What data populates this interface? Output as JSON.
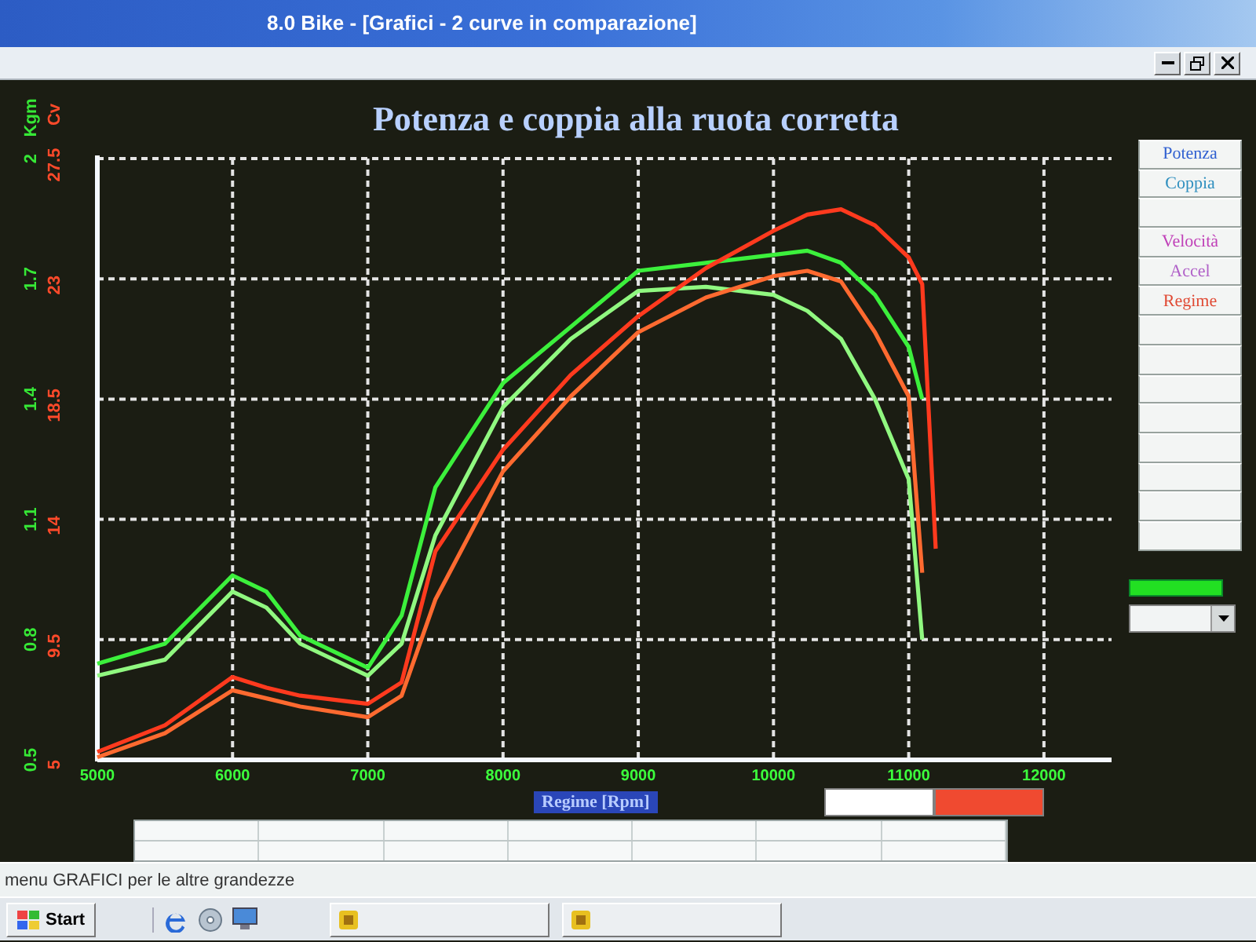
{
  "window": {
    "title": "8.0 Bike - [Grafici - 2 curve in comparazione]"
  },
  "chart": {
    "chart_data": {
      "type": "line",
      "title": "Potenza e coppia alla ruota corretta",
      "xlabel": "Regime [Rpm]",
      "ylabel": "Kgm",
      "y2label": "Cv",
      "grid": true,
      "x": [
        5000,
        5500,
        6000,
        6250,
        6500,
        7000,
        7250,
        7500,
        8000,
        8500,
        9000,
        9500,
        10000,
        10250,
        10500,
        10750,
        11000,
        11100,
        11200
      ],
      "series": [
        {
          "color": "#3cf03c",
          "axis": "y",
          "values": [
            0.74,
            0.79,
            0.96,
            0.92,
            0.81,
            0.73,
            0.86,
            1.18,
            1.44,
            1.58,
            1.72,
            1.74,
            1.76,
            1.77,
            1.74,
            1.66,
            1.53,
            1.4,
            null
          ]
        },
        {
          "color": "#90f880",
          "axis": "y",
          "values": [
            0.71,
            0.75,
            0.92,
            0.88,
            0.79,
            0.71,
            0.79,
            1.06,
            1.38,
            1.55,
            1.67,
            1.68,
            1.66,
            1.62,
            1.55,
            1.4,
            1.2,
            0.8,
            null
          ]
        },
        {
          "color": "#ff3a1e",
          "axis": "y2",
          "values": [
            5.3,
            6.3,
            8.1,
            7.7,
            7.4,
            7.1,
            7.9,
            12.8,
            16.6,
            19.4,
            21.6,
            23.4,
            24.8,
            25.4,
            25.6,
            25.0,
            23.8,
            22.8,
            12.9
          ]
        },
        {
          "color": "#ff6a30",
          "axis": "y2",
          "values": [
            5.1,
            6.0,
            7.6,
            7.3,
            7.0,
            6.6,
            7.4,
            11.0,
            15.8,
            18.6,
            21.0,
            22.3,
            23.1,
            23.3,
            22.9,
            21.0,
            18.6,
            12.0,
            null
          ]
        }
      ],
      "xlim": [
        5000,
        12500
      ],
      "ylim": [
        0.5,
        2
      ],
      "y2lim": [
        5,
        27.5
      ],
      "xticks": [
        5000,
        6000,
        7000,
        8000,
        9000,
        10000,
        11000,
        12000
      ],
      "yticks": [
        0.5,
        0.8,
        1.1,
        1.4,
        1.7,
        2
      ],
      "y2ticks": [
        5,
        9.5,
        14,
        18.5,
        23,
        27.5
      ]
    },
    "legend": [
      {
        "color": "#ffffff"
      },
      {
        "color": "#f04a30"
      }
    ]
  },
  "side_buttons": [
    {
      "kind": "label",
      "label": "Potenza",
      "color": "#2f5fd0"
    },
    {
      "kind": "label",
      "label": "Coppia",
      "color": "#2f8fbf"
    },
    {
      "kind": "blank"
    },
    {
      "kind": "label",
      "label": "Velocità",
      "color": "#c040b8"
    },
    {
      "kind": "label",
      "label": "Accel",
      "color": "#b060c8"
    },
    {
      "kind": "label",
      "label": "Regime",
      "color": "#e04a34"
    },
    {
      "kind": "blank"
    },
    {
      "kind": "blank"
    },
    {
      "kind": "blank"
    },
    {
      "kind": "blank"
    },
    {
      "kind": "blank"
    },
    {
      "kind": "blank"
    },
    {
      "kind": "blank"
    },
    {
      "kind": "blank"
    }
  ],
  "toolbar": {
    "rows": [
      [
        {
          "kind": "blank"
        },
        {
          "kind": "blank"
        },
        {
          "kind": "blank"
        },
        {
          "kind": "blank"
        },
        {
          "kind": "blank"
        },
        {
          "kind": "blank"
        },
        {
          "kind": "blank"
        }
      ],
      [
        {
          "kind": "blank"
        },
        {
          "kind": "blank"
        },
        {
          "kind": "blank"
        },
        {
          "kind": "blank"
        },
        {
          "kind": "blank"
        },
        {
          "kind": "blank"
        },
        {
          "kind": "blank"
        }
      ]
    ]
  },
  "status_bar": {
    "text": "menu GRAFICI per le altre grandezze"
  },
  "taskbar": {
    "start": "Start",
    "tasks": [
      {
        "kind": "blank"
      },
      {
        "kind": "blank"
      }
    ]
  }
}
